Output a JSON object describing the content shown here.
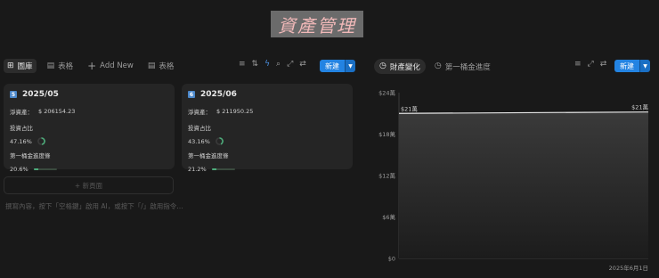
{
  "page": {
    "title": "資產管理"
  },
  "left_toolbar": {
    "tabs": [
      {
        "label": "圖庫",
        "icon": "grid-icon",
        "active": true
      },
      {
        "label": "表格",
        "icon": "table-icon",
        "active": false
      },
      {
        "label": "Add New",
        "icon": "plus-icon",
        "active": false
      },
      {
        "label": "表格",
        "icon": "table-icon",
        "active": false
      }
    ],
    "new_label": "新建"
  },
  "cards": [
    {
      "badge": "5",
      "title": "2025/05",
      "net_label": "淨資產：",
      "net_value": "$ 206154.23",
      "ratio_label": "投資占比",
      "ratio_value": "47.16%",
      "ratio": 0.4716,
      "goal_label": "第一桶金進度條",
      "goal_value": "20.6%",
      "goal": 0.206
    },
    {
      "badge": "6",
      "title": "2025/06",
      "net_label": "淨資產：",
      "net_value": "$ 211950.25",
      "ratio_label": "投資占比",
      "ratio_value": "43.16%",
      "ratio": 0.4316,
      "goal_label": "第一桶金進度條",
      "goal_value": "21.2%",
      "goal": 0.212
    }
  ],
  "new_page_label": "+ 新頁面",
  "empty_hint": "撰寫內容，按下「空格鍵」啟用 AI，或按下「/」啟用指令…",
  "right_toolbar": {
    "tabs": [
      {
        "label": "財產變化",
        "icon": "clock-icon",
        "active": true
      },
      {
        "label": "第一桶金進度",
        "icon": "clock-icon",
        "active": false
      }
    ],
    "new_label": "新建"
  },
  "colors": {
    "accent": "#2383e2",
    "progress": "#4dab7a",
    "background": "#191919",
    "card": "#252525"
  },
  "chart_data": {
    "type": "area",
    "x": [
      "2025年6月1日"
    ],
    "x_tick_labels": [
      "2025年6月1日"
    ],
    "series": [
      {
        "values": [
          21,
          21.2
        ],
        "start_label": "$21萬",
        "end_label": "$21萬"
      }
    ],
    "y_tick_labels": [
      "$0",
      "$6萬",
      "$12萬",
      "$18萬",
      "$24萬"
    ],
    "y_ticks": [
      0,
      6,
      12,
      18,
      24
    ],
    "ylim": [
      0,
      24
    ],
    "grid": false
  }
}
